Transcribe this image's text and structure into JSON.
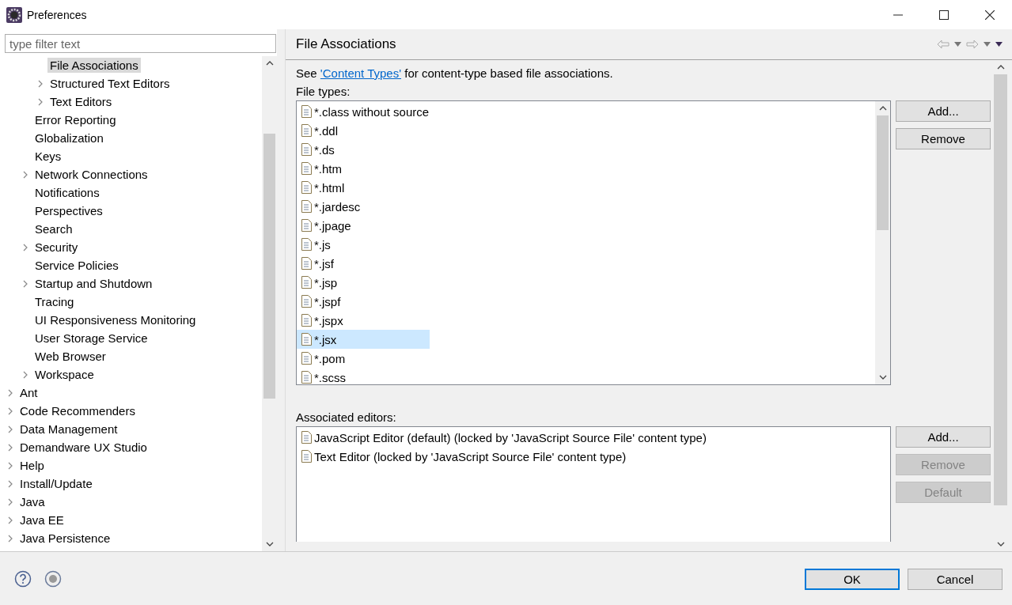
{
  "window": {
    "title": "Preferences"
  },
  "filter": {
    "placeholder": "type filter text"
  },
  "tree": {
    "items": [
      {
        "children": [
          {
            "children": [
              {
                "label": "File Associations",
                "expandable": false,
                "selected": true
              },
              {
                "label": "Structured Text Editors",
                "expandable": true,
                "selected": false
              },
              {
                "label": "Text Editors",
                "expandable": true,
                "selected": false
              }
            ]
          },
          {
            "label": "Error Reporting",
            "expandable": false,
            "selected": false
          },
          {
            "label": "Globalization",
            "expandable": false,
            "selected": false
          },
          {
            "label": "Keys",
            "expandable": false,
            "selected": false
          },
          {
            "label": "Network Connections",
            "expandable": true,
            "selected": false
          },
          {
            "label": "Notifications",
            "expandable": false,
            "selected": false
          },
          {
            "label": "Perspectives",
            "expandable": false,
            "selected": false
          },
          {
            "label": "Search",
            "expandable": false,
            "selected": false
          },
          {
            "label": "Security",
            "expandable": true,
            "selected": false
          },
          {
            "label": "Service Policies",
            "expandable": false,
            "selected": false
          },
          {
            "label": "Startup and Shutdown",
            "expandable": true,
            "selected": false
          },
          {
            "label": "Tracing",
            "expandable": false,
            "selected": false
          },
          {
            "label": "UI Responsiveness Monitoring",
            "expandable": false,
            "selected": false
          },
          {
            "label": "User Storage Service",
            "expandable": false,
            "selected": false
          },
          {
            "label": "Web Browser",
            "expandable": false,
            "selected": false
          },
          {
            "label": "Workspace",
            "expandable": true,
            "selected": false
          }
        ]
      },
      {
        "label": "Ant",
        "expandable": true,
        "selected": false
      },
      {
        "label": "Code Recommenders",
        "expandable": true,
        "selected": false
      },
      {
        "label": "Data Management",
        "expandable": true,
        "selected": false
      },
      {
        "label": "Demandware UX Studio",
        "expandable": true,
        "selected": false
      },
      {
        "label": "Help",
        "expandable": true,
        "selected": false
      },
      {
        "label": "Install/Update",
        "expandable": true,
        "selected": false
      },
      {
        "label": "Java",
        "expandable": true,
        "selected": false
      },
      {
        "label": "Java EE",
        "expandable": true,
        "selected": false
      },
      {
        "label": "Java Persistence",
        "expandable": true,
        "selected": false
      }
    ]
  },
  "page": {
    "title": "File Associations",
    "intro": {
      "before": "See ",
      "link": "'Content Types'",
      "after": " for content-type based file associations."
    },
    "file_types_label": "File types:",
    "file_types": [
      {
        "name": "*.class without source",
        "selected": false
      },
      {
        "name": "*.ddl",
        "selected": false
      },
      {
        "name": "*.ds",
        "selected": false
      },
      {
        "name": "*.htm",
        "selected": false
      },
      {
        "name": "*.html",
        "selected": false
      },
      {
        "name": "*.jardesc",
        "selected": false
      },
      {
        "name": "*.jpage",
        "selected": false
      },
      {
        "name": "*.js",
        "selected": false
      },
      {
        "name": "*.jsf",
        "selected": false
      },
      {
        "name": "*.jsp",
        "selected": false
      },
      {
        "name": "*.jspf",
        "selected": false
      },
      {
        "name": "*.jspx",
        "selected": false
      },
      {
        "name": "*.jsx",
        "selected": true
      },
      {
        "name": "*.pom",
        "selected": false
      },
      {
        "name": "*.scss",
        "selected": false
      }
    ],
    "file_type_buttons": [
      {
        "label": "Add...",
        "disabled": false
      },
      {
        "label": "Remove",
        "disabled": false
      }
    ],
    "editors_label": "Associated editors:",
    "editors": [
      "JavaScript Editor (default) (locked by 'JavaScript Source File' content type)",
      "Text Editor (locked by 'JavaScript Source File' content type)"
    ],
    "editor_buttons": [
      {
        "label": "Add...",
        "disabled": false
      },
      {
        "label": "Remove",
        "disabled": true
      },
      {
        "label": "Default",
        "disabled": true
      }
    ]
  },
  "buttons": [
    {
      "label": "OK",
      "default": true
    },
    {
      "label": "Cancel",
      "default": false
    }
  ]
}
